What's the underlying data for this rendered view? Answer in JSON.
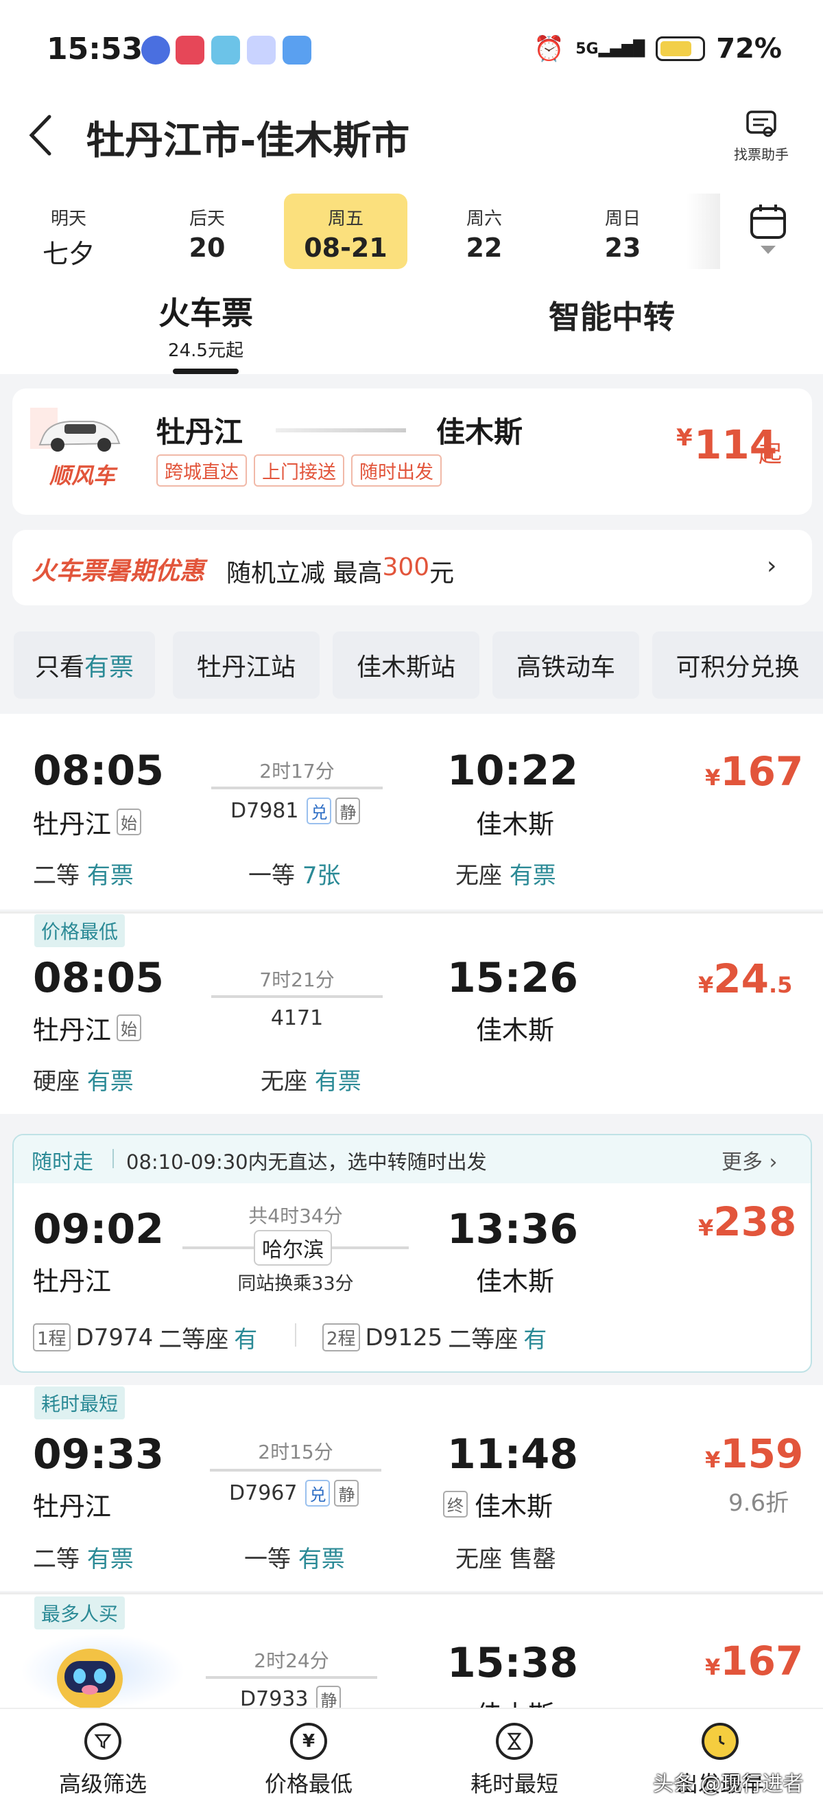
{
  "status_bar": {
    "time": "15:53",
    "battery": "72%",
    "network": "5G"
  },
  "header": {
    "title": "牡丹江市-佳木斯市",
    "helper_label": "找票助手"
  },
  "dates": [
    {
      "weekday": "明天",
      "date": "七夕",
      "active": false
    },
    {
      "weekday": "后天",
      "date": "20",
      "active": false
    },
    {
      "weekday": "周五",
      "date": "08-21",
      "active": true
    },
    {
      "weekday": "周六",
      "date": "22",
      "active": false
    },
    {
      "weekday": "周日",
      "date": "23",
      "active": false
    }
  ],
  "tabs": {
    "train_label": "火车票",
    "train_sub": "24.5元起",
    "transfer_label": "智能中转"
  },
  "carpool": {
    "logo_text": "顺风车",
    "from": "牡丹江",
    "to": "佳木斯",
    "tags": [
      "跨城直达",
      "上门接送",
      "随时出发"
    ],
    "currency": "¥",
    "price": "114",
    "suffix": "起"
  },
  "promo": {
    "title": "火车票暑期优惠",
    "text": "随机立减 最高",
    "amount": "300",
    "unit": "元"
  },
  "filters": {
    "only_prefix": "只看",
    "only_highlight": "有票",
    "chips": [
      "牡丹江站",
      "佳木斯站",
      "高铁动车",
      "可积分兑换"
    ]
  },
  "trains": [
    {
      "badge": "",
      "dep_time": "08:05",
      "dep_station": "牡丹江",
      "dep_tag": "始",
      "duration": "2时17分",
      "train_no": "D7981",
      "icons": [
        "兑",
        "静"
      ],
      "arr_time": "10:22",
      "arr_station": "佳木斯",
      "currency": "¥",
      "price": "167",
      "price_dec": "",
      "seats": [
        {
          "name": "二等",
          "status": "有票"
        },
        {
          "name": "一等",
          "status": "7张"
        },
        {
          "name": "无座",
          "status": "有票"
        }
      ]
    },
    {
      "badge": "价格最低",
      "dep_time": "08:05",
      "dep_station": "牡丹江",
      "dep_tag": "始",
      "duration": "7时21分",
      "train_no": "4171",
      "arr_time": "15:26",
      "arr_station": "佳木斯",
      "currency": "¥",
      "price": "24",
      "price_dec": ".5",
      "seats": [
        {
          "name": "硬座",
          "status": "有票"
        },
        {
          "name": "无座",
          "status": "有票"
        }
      ]
    }
  ],
  "transfer": {
    "badge": "随时走",
    "note": "08:10-09:30内无直达，选中转随时出发",
    "more": "更多",
    "dep_time": "09:02",
    "dep_station": "牡丹江",
    "total": "共4时34分",
    "via": "哈尔滨",
    "change": "同站换乘33分",
    "arr_time": "13:36",
    "arr_station": "佳木斯",
    "currency": "¥",
    "price": "238",
    "legs": [
      {
        "leg": "1程",
        "train": "D7974",
        "seat": "二等座",
        "status": "有"
      },
      {
        "leg": "2程",
        "train": "D9125",
        "seat": "二等座",
        "status": "有"
      }
    ]
  },
  "train3": {
    "badge": "耗时最短",
    "dep_time": "09:33",
    "dep_station": "牡丹江",
    "duration": "2时15分",
    "train_no": "D7967",
    "icons": [
      "兑",
      "静"
    ],
    "arr_time": "11:48",
    "arr_station": "佳木斯",
    "arr_tag": "终",
    "currency": "¥",
    "price": "159",
    "discount": "9.6折",
    "seats": [
      {
        "name": "二等",
        "status": "有票"
      },
      {
        "name": "一等",
        "status": "有票"
      },
      {
        "name": "无座",
        "status": "售罄"
      }
    ]
  },
  "train4": {
    "badge": "最多人买",
    "duration": "2时24分",
    "train_no": "D7933",
    "icon": "静",
    "arr_time": "15:38",
    "arr_station": "佳木斯",
    "currency": "¥",
    "price": "167"
  },
  "bottom_bar": [
    {
      "label": "高级筛选",
      "icon": "filter-icon"
    },
    {
      "label": "价格最低",
      "icon": "yen-icon"
    },
    {
      "label": "耗时最短",
      "icon": "hourglass-icon"
    },
    {
      "label": "出发最早",
      "icon": "clock-icon"
    }
  ],
  "watermark": "头条 @现行进者"
}
